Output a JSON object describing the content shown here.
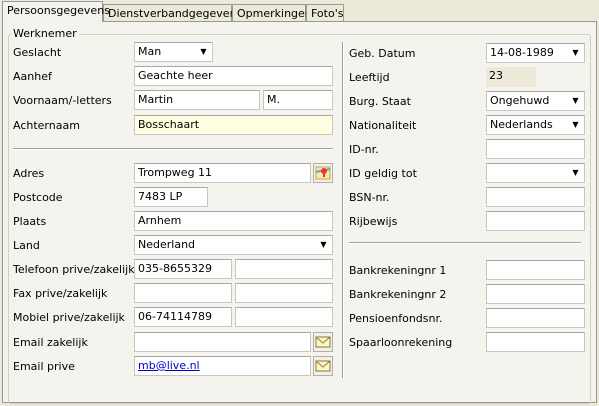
{
  "tabs": [
    {
      "label": "Persoonsgegevens"
    },
    {
      "label": "Dienstverbandgegevens"
    },
    {
      "label": "Opmerkingen"
    },
    {
      "label": "Foto's"
    }
  ],
  "group_label": "Werknemer",
  "left": {
    "geslacht": {
      "label": "Geslacht",
      "value": "Man"
    },
    "aanhef": {
      "label": "Aanhef",
      "value": "Geachte heer"
    },
    "voornaam": {
      "label": "Voornaam/-letters",
      "value": "Martin",
      "initials": "M."
    },
    "achternaam": {
      "label": "Achternaam",
      "value": "Bosschaart"
    },
    "adres": {
      "label": "Adres",
      "value": "Trompweg 11"
    },
    "postcode": {
      "label": "Postcode",
      "value": "7483 LP"
    },
    "plaats": {
      "label": "Plaats",
      "value": "Arnhem"
    },
    "land": {
      "label": "Land",
      "value": "Nederland"
    },
    "telefoon": {
      "label": "Telefoon prive/zakelijk",
      "prive": "035-8655329",
      "zakelijk": ""
    },
    "fax": {
      "label": "Fax prive/zakelijk",
      "prive": "",
      "zakelijk": ""
    },
    "mobiel": {
      "label": "Mobiel prive/zakelijk",
      "prive": "06-74114789",
      "zakelijk": ""
    },
    "email_zakelijk": {
      "label": "Email zakelijk",
      "value": ""
    },
    "email_prive": {
      "label": "Email prive",
      "value": "mb@live.nl"
    }
  },
  "right": {
    "geb_datum": {
      "label": "Geb. Datum",
      "value": "14-08-1989"
    },
    "leeftijd": {
      "label": "Leeftijd",
      "value": "23"
    },
    "burg_staat": {
      "label": "Burg. Staat",
      "value": "Ongehuwd"
    },
    "nationaliteit": {
      "label": "Nationaliteit",
      "value": "Nederlands"
    },
    "id_nr": {
      "label": "ID-nr.",
      "value": ""
    },
    "id_geldig": {
      "label": "ID geldig tot",
      "value": ""
    },
    "bsn": {
      "label": "BSN-nr.",
      "value": ""
    },
    "rijbewijs": {
      "label": "Rijbewijs",
      "value": ""
    },
    "bank1": {
      "label": "Bankrekeningnr 1",
      "value": ""
    },
    "bank2": {
      "label": "Bankrekeningnr 2",
      "value": ""
    },
    "pensioen": {
      "label": "Pensioenfondsnr.",
      "value": ""
    },
    "spaarloon": {
      "label": "Spaarloonrekening",
      "value": ""
    }
  },
  "icons": {
    "map": "map-icon",
    "envelope": "envelope-icon",
    "dropdown": "chevron-down-icon"
  }
}
